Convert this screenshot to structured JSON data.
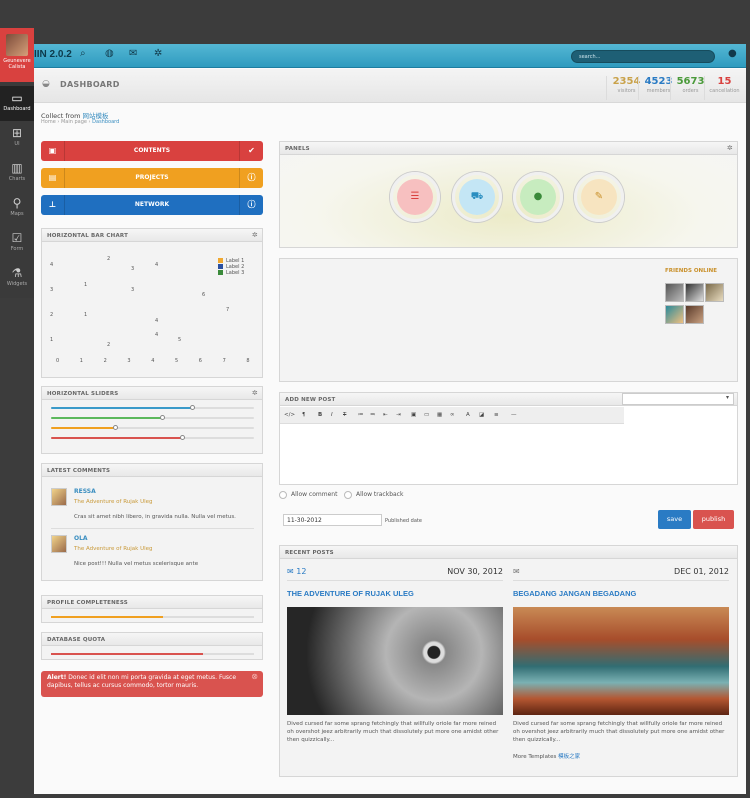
{
  "user": {
    "name": "Geunevere Calista"
  },
  "sidebar": {
    "items": [
      {
        "label": "Dashboard",
        "icon": "monitor-icon"
      },
      {
        "label": "UI",
        "icon": "gift-icon"
      },
      {
        "label": "Charts",
        "icon": "bar-chart-icon"
      },
      {
        "label": "Maps",
        "icon": "map-pin-icon"
      },
      {
        "label": "Form",
        "icon": "checkbox-icon"
      },
      {
        "label": "Widgets",
        "icon": "flask-icon"
      }
    ]
  },
  "topbar": {
    "brand": "IIN 2.0.2",
    "search_placeholder": "search..."
  },
  "header": {
    "title": "DASHBOARD"
  },
  "stats": [
    {
      "value": "2354",
      "label": "visitors",
      "color": "#c9a24a"
    },
    {
      "value": "4523",
      "label": "members",
      "color": "#2a7bc4"
    },
    {
      "value": "5673",
      "label": "orders",
      "color": "#4a9a3a"
    },
    {
      "value": "15",
      "label": "cancellation",
      "color": "#d9413f"
    }
  ],
  "breadcrumb": {
    "collect_text": "Collect from",
    "collect_link": "网站模板",
    "items": [
      "Home",
      "Main page",
      "Dashboard"
    ]
  },
  "buttons": [
    {
      "label": "CONTENTS",
      "color": "#d9413f"
    },
    {
      "label": "PROJECTS",
      "color": "#f0a020"
    },
    {
      "label": "NETWORK",
      "color": "#1f6fc0"
    }
  ],
  "bar_chart": {
    "title": "HORIZONTAL BAR CHART",
    "chart_data": {
      "type": "bar",
      "orientation": "horizontal",
      "series": [
        {
          "name": "Label 1",
          "color": "#f0a830"
        },
        {
          "name": "Label 2",
          "color": "#2a4fa0"
        },
        {
          "name": "Label 3",
          "color": "#3a8a3a"
        }
      ],
      "xticks": [
        "0",
        "1",
        "2",
        "3",
        "4",
        "5",
        "6",
        "7",
        "8"
      ],
      "yticks": [
        "1",
        "2",
        "3",
        "4"
      ],
      "data_labels": [
        "4",
        "2",
        "3",
        "4",
        "3",
        "1",
        "3",
        "6",
        "2",
        "1",
        "7",
        "4",
        "1",
        "2",
        "4",
        "5"
      ]
    }
  },
  "sliders": {
    "title": "HORIZONTAL SLIDERS",
    "items": [
      {
        "fill": 0.7,
        "color": "#3a9ac9"
      },
      {
        "fill": 0.55,
        "color": "#5cb85c"
      },
      {
        "fill": 0.32,
        "color": "#f0a020"
      },
      {
        "fill": 0.65,
        "color": "#d9534f"
      }
    ]
  },
  "comments": {
    "title": "LATEST COMMENTS",
    "items": [
      {
        "name": "RESSA",
        "post": "The Adventure of Rujak Uleg",
        "text": "Cras sit amet nibh libero, in gravida nulla. Nulla vel metus."
      },
      {
        "name": "OLA",
        "post": "The Adventure of Rujak Uleg",
        "text": "Nice post!!! Nulla vel metus scelerisque ante"
      }
    ]
  },
  "profile": {
    "title": "PROFILE COMPLETENESS",
    "value": 0.55,
    "color": "#f0a020"
  },
  "quota": {
    "title": "DATABASE QUOTA",
    "value": 0.75,
    "color": "#d9534f"
  },
  "alert": {
    "title": "Alert!",
    "text": "Donec id elit non mi porta gravida at eget metus. Fusce dapibus, tellus ac cursus commodo, tortor mauris."
  },
  "panels": {
    "title": "PANELS",
    "items": [
      {
        "icon": "list-icon",
        "bg": "#f7c0c0",
        "fg": "#d9413f"
      },
      {
        "icon": "cart-icon",
        "bg": "#c4e6f5",
        "fg": "#2a8ec0"
      },
      {
        "icon": "user-icon",
        "bg": "#c7ecbf",
        "fg": "#3a8a3a"
      },
      {
        "icon": "chat-icon",
        "bg": "#f7e4c0",
        "fg": "#c9902a"
      }
    ]
  },
  "friends": {
    "title": "FRIENDS ONLINE"
  },
  "new_post": {
    "title": "ADD NEW POST",
    "allow_comment": "Allow comment",
    "allow_trackback": "Allow trackback",
    "date_value": "11-30-2012",
    "date_label": "Published date",
    "save": "save",
    "publish": "publish"
  },
  "recent_posts": {
    "title": "RECENT POSTS",
    "items": [
      {
        "comments": "12",
        "date": "NOV 30, 2012",
        "title": "THE ADVENTURE OF RUJAK ULEG",
        "text": "Dived cursed far some sprang fetchingly that willfully oriole far more reined oh overshot jeez arbitrarily much that dissolutely put more one amidst other then quizzically..."
      },
      {
        "comments": "",
        "date": "DEC 01, 2012",
        "title": "BEGADANG JANGAN BEGADANG",
        "text": "Dived cursed far some sprang fetchingly that willfully oriole far more reined oh overshot jeez arbitrarily much that dissolutely put more one amidst other then quizzically..."
      }
    ],
    "more_text": "More Templates",
    "more_link": "模板之家"
  }
}
